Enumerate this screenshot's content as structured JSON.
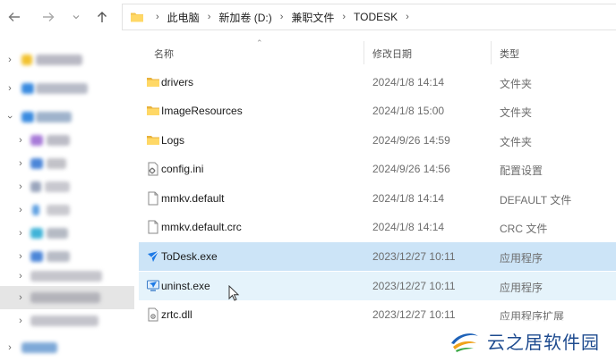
{
  "address": {
    "crumbs": [
      "此电脑",
      "新加卷 (D:)",
      "兼职文件",
      "TODESK"
    ]
  },
  "columns": {
    "name": "名称",
    "date": "修改日期",
    "type": "类型"
  },
  "files": [
    {
      "name": "drivers",
      "date": "2024/1/8 14:14",
      "type": "文件夹",
      "icon": "folder-icon"
    },
    {
      "name": "ImageResources",
      "date": "2024/1/8 15:00",
      "type": "文件夹",
      "icon": "folder-icon"
    },
    {
      "name": "Logs",
      "date": "2024/9/26 14:59",
      "type": "文件夹",
      "icon": "folder-icon"
    },
    {
      "name": "config.ini",
      "date": "2024/9/26 14:56",
      "type": "配置设置",
      "icon": "settings-file-icon"
    },
    {
      "name": "mmkv.default",
      "date": "2024/1/8 14:14",
      "type": "DEFAULT 文件",
      "icon": "file-icon"
    },
    {
      "name": "mmkv.default.crc",
      "date": "2024/1/8 14:14",
      "type": "CRC 文件",
      "icon": "file-icon"
    },
    {
      "name": "ToDesk.exe",
      "date": "2023/12/27 10:11",
      "type": "应用程序",
      "icon": "todesk-app-icon",
      "state": "selected"
    },
    {
      "name": "uninst.exe",
      "date": "2023/12/27 10:11",
      "type": "应用程序",
      "icon": "installer-app-icon",
      "state": "hover"
    },
    {
      "name": "zrtc.dll",
      "date": "2023/12/27 10:11",
      "type": "应用程序扩展",
      "icon": "dll-file-icon"
    }
  ],
  "watermark": {
    "text": "云之居软件园"
  },
  "colors": {
    "selected_row": "#cce4f7",
    "hover_row": "#e5f3fb",
    "folder": "#f3c44d",
    "todesk_blue": "#1d7ae6"
  }
}
